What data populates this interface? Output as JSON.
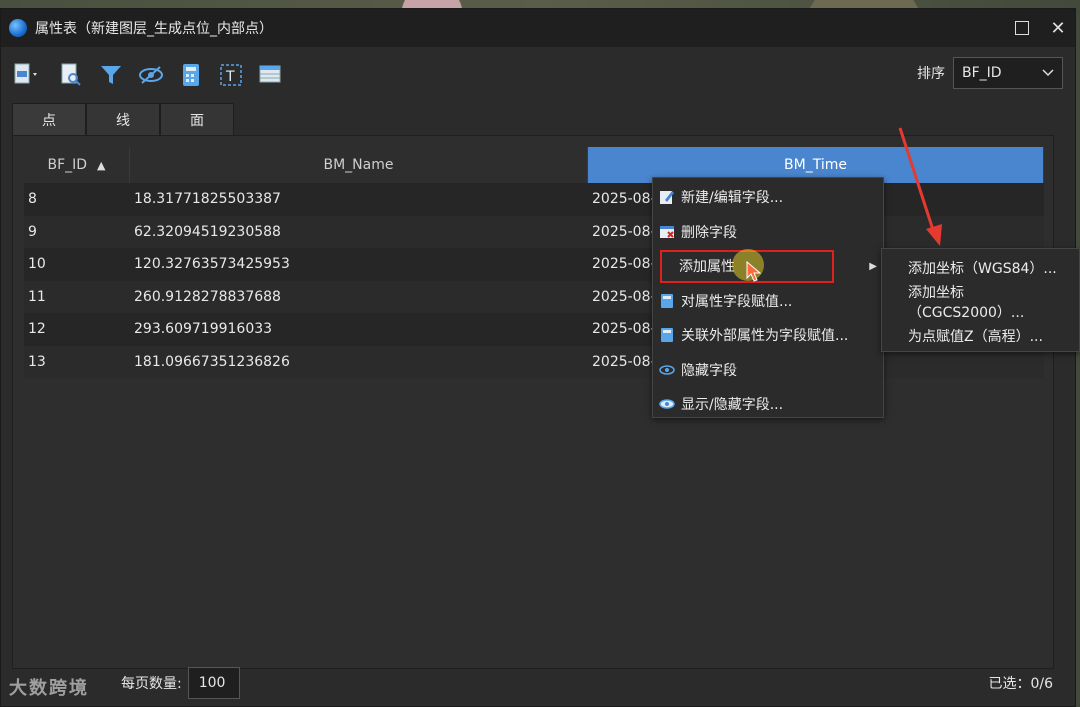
{
  "window": {
    "title": "属性表（新建图层_生成点位_内部点）"
  },
  "toolbar": {
    "tools": [
      "export-icon",
      "zoom-to-icon",
      "filter-icon",
      "hide-icon",
      "calculator-icon",
      "text-field-icon",
      "table-view-icon"
    ],
    "sort_label": "排序",
    "sort_value": "BF_ID"
  },
  "tabs": [
    {
      "label": "点"
    },
    {
      "label": "线"
    },
    {
      "label": "面"
    }
  ],
  "table": {
    "headers": [
      "BF_ID",
      "BM_Name",
      "BM_Time"
    ],
    "rows": [
      {
        "id": "8",
        "name": "18.31771825503387",
        "time": "2025-08-"
      },
      {
        "id": "9",
        "name": "62.32094519230588",
        "time": "2025-08-"
      },
      {
        "id": "10",
        "name": "120.32763573425953",
        "time": "2025-08-"
      },
      {
        "id": "11",
        "name": "260.9128278837688",
        "time": "2025-08-"
      },
      {
        "id": "12",
        "name": "293.609719916033",
        "time": "2025-08-"
      },
      {
        "id": "13",
        "name": "181.09667351236826",
        "time": "2025-08-"
      }
    ]
  },
  "context_menu": {
    "items": [
      {
        "label": "新建/编辑字段...",
        "icon": "edit-field-icon"
      },
      {
        "label": "删除字段",
        "icon": "delete-field-icon"
      },
      {
        "label": "添加属性",
        "icon": "",
        "submenu": true
      },
      {
        "label": "对属性字段赋值...",
        "icon": "assign-value-icon"
      },
      {
        "label": "关联外部属性为字段赋值...",
        "icon": "link-assign-icon"
      },
      {
        "label": "隐藏字段",
        "icon": "hide-field-icon"
      },
      {
        "label": "显示/隐藏字段...",
        "icon": "show-hide-field-icon"
      }
    ],
    "submenu": [
      {
        "label": "添加坐标（WGS84）..."
      },
      {
        "label": "添加坐标（CGCS2000）..."
      },
      {
        "label": "为点赋值Z（高程）..."
      }
    ]
  },
  "footer": {
    "page_size_label": "每页数量:",
    "page_size": "100",
    "selected": "已选：0/6",
    "watermark": "大数跨境"
  },
  "colors": {
    "accent": "#4a86cf",
    "highlight": "#e0201c",
    "annotation": "#e53a2f"
  }
}
